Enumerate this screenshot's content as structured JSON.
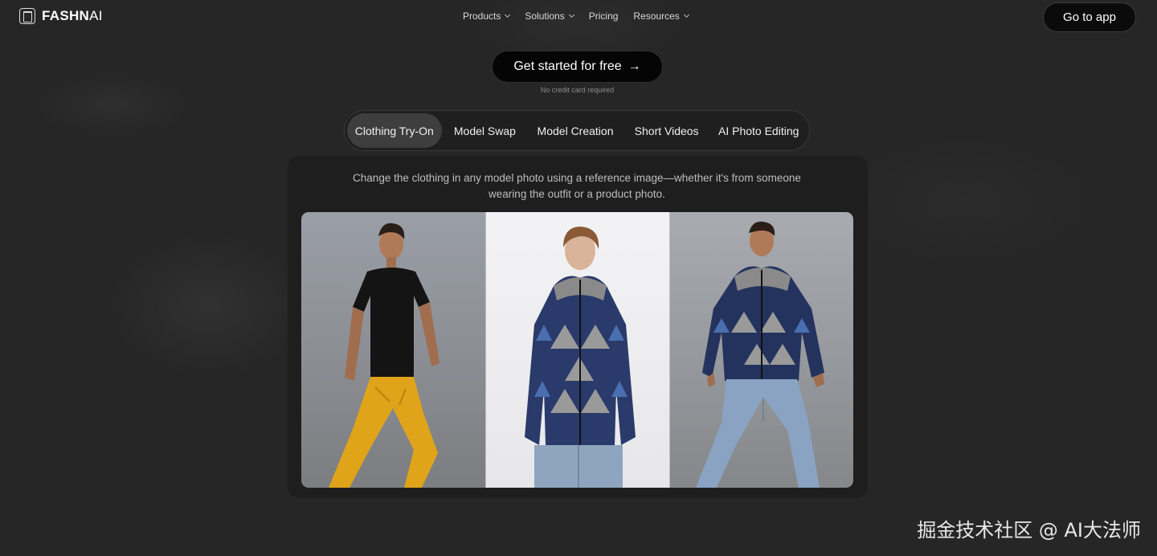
{
  "brand": {
    "name_bold": "FASHN",
    "name_thin": "AI"
  },
  "nav": {
    "items": [
      {
        "label": "Products",
        "has_dropdown": true
      },
      {
        "label": "Solutions",
        "has_dropdown": true
      },
      {
        "label": "Pricing",
        "has_dropdown": false
      },
      {
        "label": "Resources",
        "has_dropdown": true
      }
    ],
    "go_to_app": "Go to app"
  },
  "cta": {
    "label": "Get started for free",
    "arrow": "→",
    "note": "No credit card required"
  },
  "tabs": [
    {
      "label": "Clothing Try-On",
      "active": true
    },
    {
      "label": "Model Swap",
      "active": false
    },
    {
      "label": "Model Creation",
      "active": false
    },
    {
      "label": "Short Videos",
      "active": false
    },
    {
      "label": "AI Photo Editing",
      "active": false
    }
  ],
  "panel": {
    "description": "Change the clothing in any model photo using a reference image—whether it's from someone wearing the outfit or a product photo."
  },
  "watermark": "掘金技术社区 @ AI大法师",
  "colors": {
    "background": "#262626",
    "panel": "#1e1e1e",
    "active_tab": "#3e3e3e",
    "button": "#050505"
  }
}
